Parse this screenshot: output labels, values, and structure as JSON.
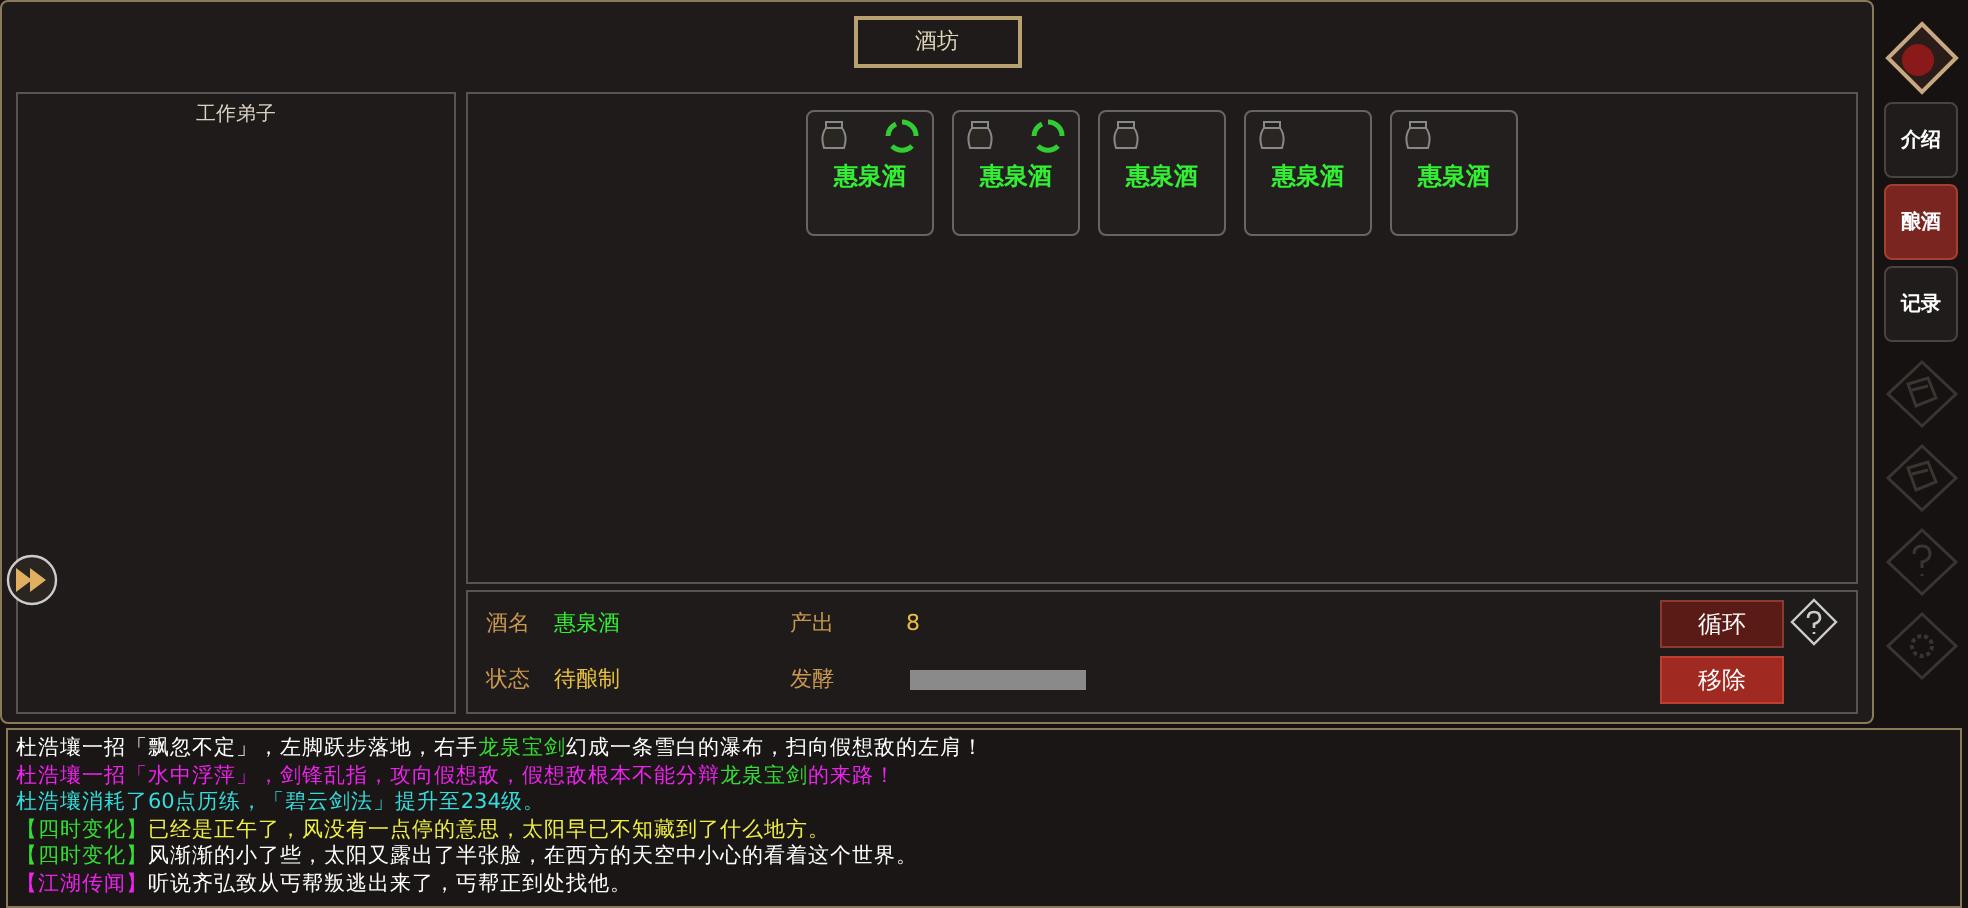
{
  "title": "酒坊",
  "workers": {
    "title": "工作弟子"
  },
  "wines": [
    {
      "name": "惠泉酒",
      "cycling": true
    },
    {
      "name": "惠泉酒",
      "cycling": true
    },
    {
      "name": "惠泉酒",
      "cycling": false
    },
    {
      "name": "惠泉酒",
      "cycling": false
    },
    {
      "name": "惠泉酒",
      "cycling": false
    }
  ],
  "info": {
    "name_label": "酒名",
    "name": "惠泉酒",
    "output_label": "产出",
    "output": "8",
    "status_label": "状态",
    "status": "待酿制",
    "ferment_label": "发酵",
    "level": 0,
    "buttons": [
      {
        "label": "循环",
        "kind": "dark"
      },
      {
        "label": "移除",
        "kind": "red"
      }
    ]
  },
  "tabs": [
    {
      "label": "介绍",
      "selected": false
    },
    {
      "label": "酿酒",
      "selected": true
    },
    {
      "label": "记录",
      "selected": false
    }
  ],
  "side_icons": [
    {
      "kind": "scroll"
    },
    {
      "kind": "scroll"
    },
    {
      "kind": "help"
    },
    {
      "kind": "gear"
    }
  ],
  "log": [
    [
      {
        "text": "杜浩壤一招「飘忽不定」，左脚跃步落地，右手",
        "color": "#ffffff"
      },
      {
        "text": "龙泉宝剑",
        "color": "#33dd33"
      },
      {
        "text": "幻成一条雪白的瀑布，扫向假想敌的左肩！",
        "color": "#ffffff"
      }
    ],
    [
      {
        "text": "杜浩壤一招「水中浮萍」，剑锋乱指，攻向假想敌，假想敌根本不能分辩",
        "color": "#ee22ee"
      },
      {
        "text": "龙泉宝剑",
        "color": "#33dd33"
      },
      {
        "text": "的来路！",
        "color": "#ee22ee"
      }
    ],
    [
      {
        "text": "杜浩壤消耗了60点历练，「碧云剑法」提升至234级。",
        "color": "#33dddd"
      }
    ],
    [
      {
        "text": "【四时变化】",
        "color": "#33dd33"
      },
      {
        "text": "已经是正午了，风没有一点停的意思，太阳早已不知藏到了什么地方。",
        "color": "#eeee44"
      }
    ],
    [
      {
        "text": "【四时变化】",
        "color": "#33dd33"
      },
      {
        "text": "风渐渐的小了些，太阳又露出了半张脸，在西方的天空中小心的看着这个世界。",
        "color": "#ffffff"
      }
    ],
    [
      {
        "text": "【江湖传闻】",
        "color": "#ee22ee"
      },
      {
        "text": "听说齐弘致从丐帮叛逃出来了，丐帮正到处找他。",
        "color": "#ffffff"
      }
    ]
  ]
}
